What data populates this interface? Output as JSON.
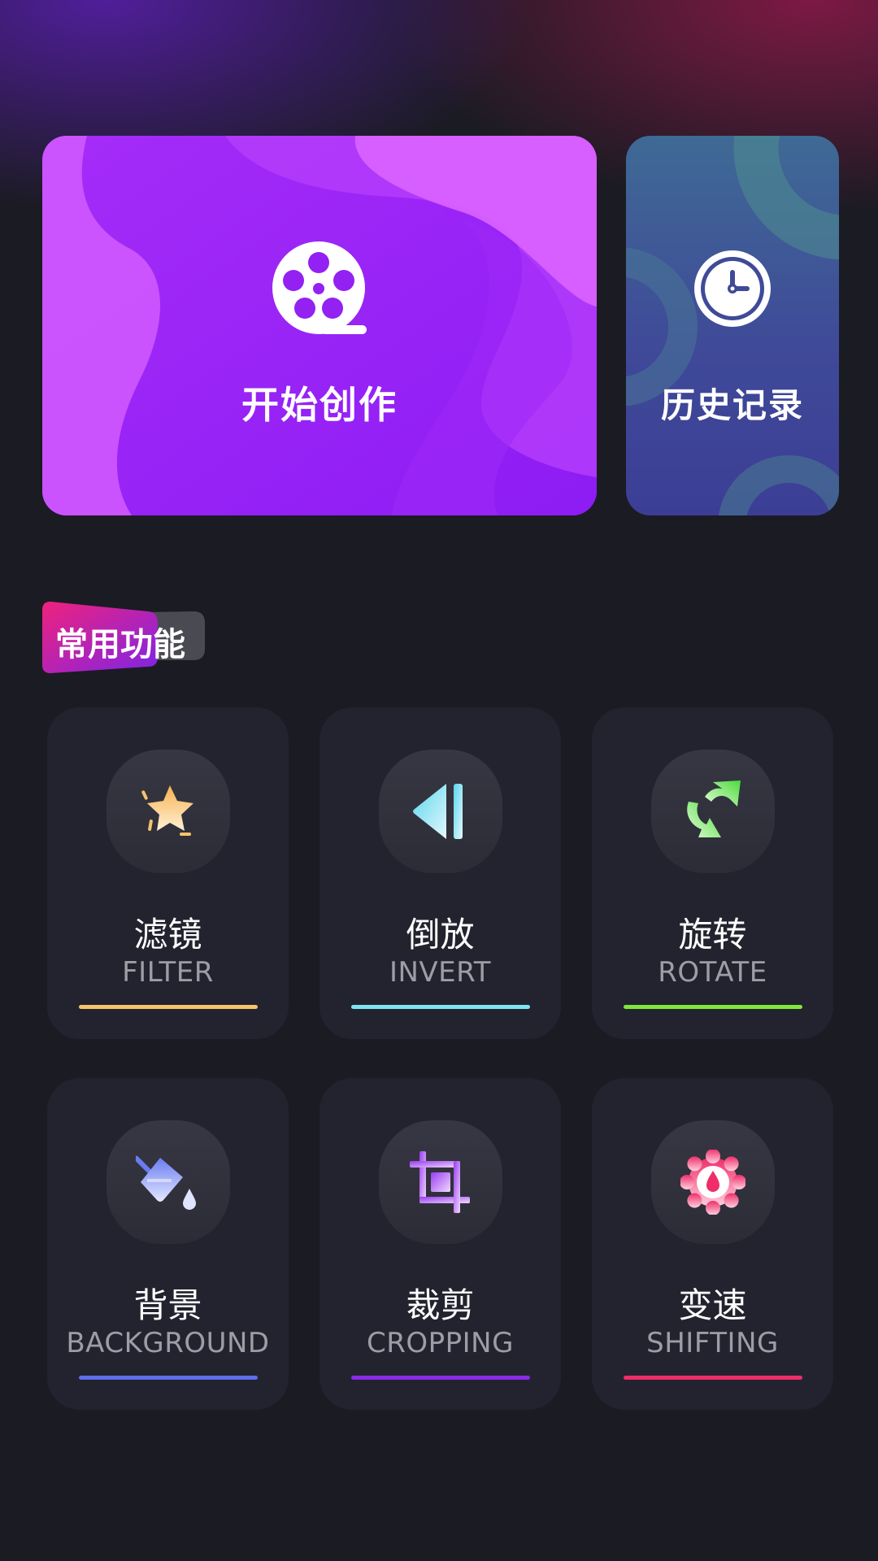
{
  "header": {
    "create_card": {
      "title": "开始创作",
      "icon": "film-reel-icon"
    },
    "history_card": {
      "title": "历史记录",
      "icon": "clock-icon"
    }
  },
  "section": {
    "title": "常用功能"
  },
  "features": [
    {
      "name_cn": "滤镜",
      "name_en": "FILTER",
      "icon": "sparkle-star-icon",
      "accent": "#f7c46c"
    },
    {
      "name_cn": "倒放",
      "name_en": "INVERT",
      "icon": "rewind-icon",
      "accent": "#7ee4f2"
    },
    {
      "name_cn": "旋转",
      "name_en": "ROTATE",
      "icon": "rotate-arrows-icon",
      "accent": "#7de83c"
    },
    {
      "name_cn": "背景",
      "name_en": "BACKGROUND",
      "icon": "paint-bucket-icon",
      "accent": "#5c6ee8"
    },
    {
      "name_cn": "裁剪",
      "name_en": "CROPPING",
      "icon": "crop-icon",
      "accent": "#8a2be8"
    },
    {
      "name_cn": "变速",
      "name_en": "SHIFTING",
      "icon": "speed-gear-icon",
      "accent": "#ef2d6a"
    }
  ]
}
